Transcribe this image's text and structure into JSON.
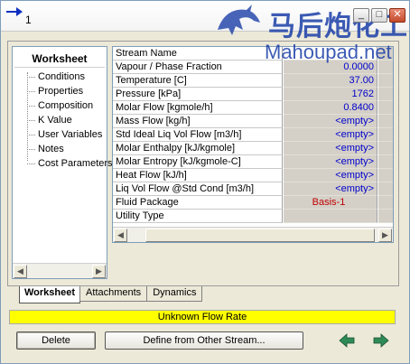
{
  "window": {
    "title": "1",
    "buttons": [
      "_",
      "□",
      "✕"
    ]
  },
  "watermark": {
    "cn": "马后炮化工",
    "en": "Mahoupad.net"
  },
  "tree": {
    "title": "Worksheet",
    "items": [
      "Conditions",
      "Properties",
      "Composition",
      "K Value",
      "User Variables",
      "Notes",
      "Cost Parameters"
    ]
  },
  "grid": {
    "header": "Stream Name",
    "rows": [
      {
        "label": "Vapour / Phase Fraction",
        "value": "0.0000"
      },
      {
        "label": "Temperature [C]",
        "value": "37.00"
      },
      {
        "label": "Pressure [kPa]",
        "value": "1762"
      },
      {
        "label": "Molar Flow [kgmole/h]",
        "value": "0.8400"
      },
      {
        "label": "Mass Flow [kg/h]",
        "value": "<empty>"
      },
      {
        "label": "Std Ideal Liq Vol Flow [m3/h]",
        "value": "<empty>"
      },
      {
        "label": "Molar Enthalpy [kJ/kgmole]",
        "value": "<empty>"
      },
      {
        "label": "Molar Entropy [kJ/kgmole-C]",
        "value": "<empty>"
      },
      {
        "label": "Heat Flow [kJ/h]",
        "value": "<empty>"
      },
      {
        "label": "Liq Vol Flow @Std Cond [m3/h]",
        "value": "<empty>"
      },
      {
        "label": "Fluid Package",
        "value": "Basis-1"
      },
      {
        "label": "Utility Type",
        "value": ""
      }
    ]
  },
  "tabs": [
    "Worksheet",
    "Attachments",
    "Dynamics"
  ],
  "status": "Unknown Flow Rate",
  "buttons": {
    "delete": "Delete",
    "define": "Define from Other Stream..."
  },
  "colors": {
    "status_bg": "#ffff00",
    "value_blue": "#0000cc",
    "value_red": "#c00000",
    "arrow_green": "#2e8b57"
  }
}
